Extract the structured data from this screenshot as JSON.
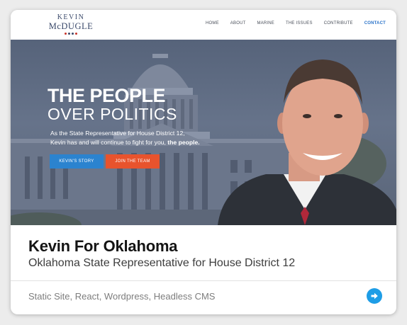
{
  "site": {
    "logo": {
      "line1": "KEVIN",
      "line2": "McDUGLE"
    },
    "nav": [
      "HOME",
      "ABOUT",
      "MARINE",
      "THE ISSUES",
      "CONTRIBUTE",
      "CONTACT"
    ],
    "active_nav": "CONTACT",
    "hero": {
      "headline_1": "THE PEOPLE",
      "headline_2": "OVER POLITICS",
      "intro_1": "As the State Representative for House District 12,",
      "intro_2": "Kevin has and will continue to fight for you,",
      "intro_emphasis": "the people.",
      "button_story": "KEVIN'S STORY",
      "button_team": "JOIN THE TEAM"
    }
  },
  "card": {
    "title": "Kevin For Oklahoma",
    "subtitle": "Oklahoma State Representative for House District 12",
    "tech": "Static Site, React, Wordpress, Headless CMS",
    "link_icon": "arrow-right-circle-icon"
  },
  "colors": {
    "accent_blue": "#2b83cf",
    "accent_red": "#e8532d",
    "link_button": "#1e9de6",
    "nav_active": "#2a73c9",
    "hero_overlay": "#5f6b82"
  }
}
